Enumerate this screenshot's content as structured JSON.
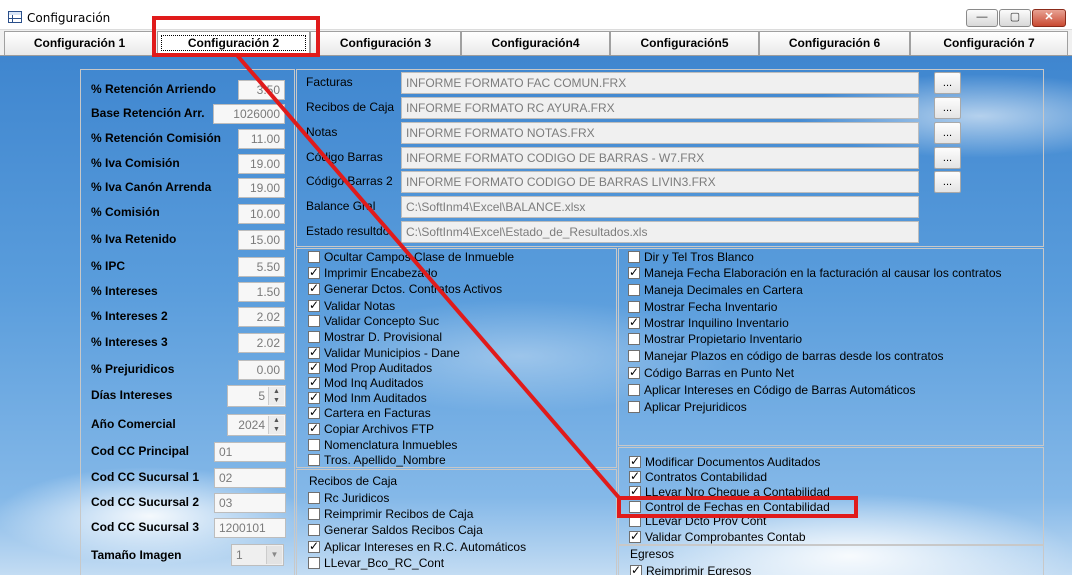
{
  "window": {
    "title": "Configuración"
  },
  "tabs": [
    {
      "label": "Configuración 1"
    },
    {
      "label": "Configuración 2"
    },
    {
      "label": "Configuración 3"
    },
    {
      "label": "Configuración4"
    },
    {
      "label": "Configuración5"
    },
    {
      "label": "Configuración 6"
    },
    {
      "label": "Configuración 7"
    }
  ],
  "params": [
    {
      "label": "% Retención Arriendo",
      "value": "3.50"
    },
    {
      "label": "Base Retención Arr.",
      "value": "1026000"
    },
    {
      "label": "% Retención Comisión",
      "value": "11.00"
    },
    {
      "label": "% Iva Comisión",
      "value": "19.00"
    },
    {
      "label": "% Iva Canón Arrenda",
      "value": "19.00"
    },
    {
      "label": "% Comisión",
      "value": "10.00"
    },
    {
      "label": "% Iva Retenido",
      "value": "15.00"
    },
    {
      "label": "% IPC",
      "value": "5.50"
    },
    {
      "label": "% Intereses",
      "value": "1.50"
    },
    {
      "label": "% Intereses 2",
      "value": "2.02"
    },
    {
      "label": "% Intereses 3",
      "value": "2.02"
    },
    {
      "label": "% Prejuridicos",
      "value": "0.00"
    },
    {
      "label": "Días Intereses",
      "value": "5"
    },
    {
      "label": "Año Comercial",
      "value": "2024"
    },
    {
      "label": "Cod CC Principal",
      "value": "01"
    },
    {
      "label": "Cod CC Sucursal 1",
      "value": "02"
    },
    {
      "label": "Cod CC Sucursal 2",
      "value": "03"
    },
    {
      "label": "Cod CC Sucursal 3",
      "value": "1200101"
    },
    {
      "label": "Tamaño Imagen",
      "value": "1"
    }
  ],
  "reports": [
    {
      "label": "Facturas",
      "value": "INFORME FORMATO FAC COMUN.FRX",
      "button": "..."
    },
    {
      "label": "Recibos de Caja",
      "value": "INFORME FORMATO RC AYURA.FRX",
      "button": "..."
    },
    {
      "label": "Notas",
      "value": "INFORME FORMATO NOTAS.FRX",
      "button": "..."
    },
    {
      "label": "Código Barras",
      "value": "INFORME FORMATO CODIGO DE BARRAS - W7.FRX",
      "button": "..."
    },
    {
      "label": "Código Barras 2",
      "value": "INFORME FORMATO CODIGO DE BARRAS LIVIN3.FRX",
      "button": "..."
    },
    {
      "label": "Balance Gral",
      "value": "C:\\SoftInm4\\Excel\\BALANCE.xlsx"
    },
    {
      "label": "Estado resultdo",
      "value": "C:\\SoftInm4\\Excel\\Estado_de_Resultados.xls"
    }
  ],
  "checks_left": [
    {
      "label": "Ocultar Campos Clase de Inmueble",
      "checked": false
    },
    {
      "label": "Imprimir Encabezado",
      "checked": true
    },
    {
      "label": "Generar Dctos. Contratos Activos",
      "checked": true
    },
    {
      "label": "Validar Notas",
      "checked": true
    },
    {
      "label": "Validar Concepto Suc",
      "checked": false
    },
    {
      "label": "Mostrar D. Provisional",
      "checked": false
    },
    {
      "label": "Validar Municipios - Dane",
      "checked": true
    },
    {
      "label": "Mod Prop Auditados",
      "checked": true
    },
    {
      "label": "Mod Inq Auditados",
      "checked": true
    },
    {
      "label": "Mod Inm Auditados",
      "checked": true
    },
    {
      "label": "Cartera en Facturas",
      "checked": true
    },
    {
      "label": "Copiar Archivos FTP",
      "checked": true
    },
    {
      "label": "Nomenclatura Inmuebles",
      "checked": false
    },
    {
      "label": "Tros. Apellido_Nombre",
      "checked": false
    }
  ],
  "checks_right": [
    {
      "label": "Dir y Tel Tros Blanco",
      "checked": false
    },
    {
      "label": "Maneja Fecha Elaboración en la facturación al causar los contratos",
      "checked": true
    },
    {
      "label": "Maneja Decimales en Cartera",
      "checked": false
    },
    {
      "label": "Mostrar Fecha Inventario",
      "checked": false
    },
    {
      "label": "Mostrar Inquilino Inventario",
      "checked": true
    },
    {
      "label": "Mostrar Propietario Inventario",
      "checked": false
    },
    {
      "label": "Manejar Plazos en código de barras desde los contratos",
      "checked": false
    },
    {
      "label": "Código Barras en Punto Net",
      "checked": true
    },
    {
      "label": "Aplicar Intereses en Código de Barras Automáticos",
      "checked": false
    },
    {
      "label": "Aplicar Prejuridicos",
      "checked": false
    }
  ],
  "checks_right2": [
    {
      "label": "Modificar Documentos Auditados",
      "checked": true
    },
    {
      "label": "Contratos Contabilidad",
      "checked": true
    },
    {
      "label": "LLevar Nro Cheque a Contabilidad",
      "checked": true
    },
    {
      "label": "Control de Fechas en Contabilidad",
      "checked": false
    },
    {
      "label": "LLevar Dcto Prov Cont",
      "checked": false
    },
    {
      "label": "Validar Comprobantes Contab",
      "checked": true
    }
  ],
  "recibos": {
    "title": "Recibos de Caja",
    "items": [
      {
        "label": "Rc Juridicos",
        "checked": false
      },
      {
        "label": "Reimprimir Recibos de Caja",
        "checked": false
      },
      {
        "label": "Generar Saldos Recibos Caja",
        "checked": false
      },
      {
        "label": "Aplicar Intereses en R.C. Automáticos",
        "checked": true
      },
      {
        "label": "LLevar_Bco_RC_Cont",
        "checked": false
      }
    ]
  },
  "egresos": {
    "title": "Egresos",
    "items": [
      {
        "label": "Reimprimir Egresos",
        "checked": true
      }
    ]
  },
  "controls": {
    "minimize": "—",
    "maximize": "▢",
    "close": "✕"
  },
  "annotation_color": "#e01b1b"
}
